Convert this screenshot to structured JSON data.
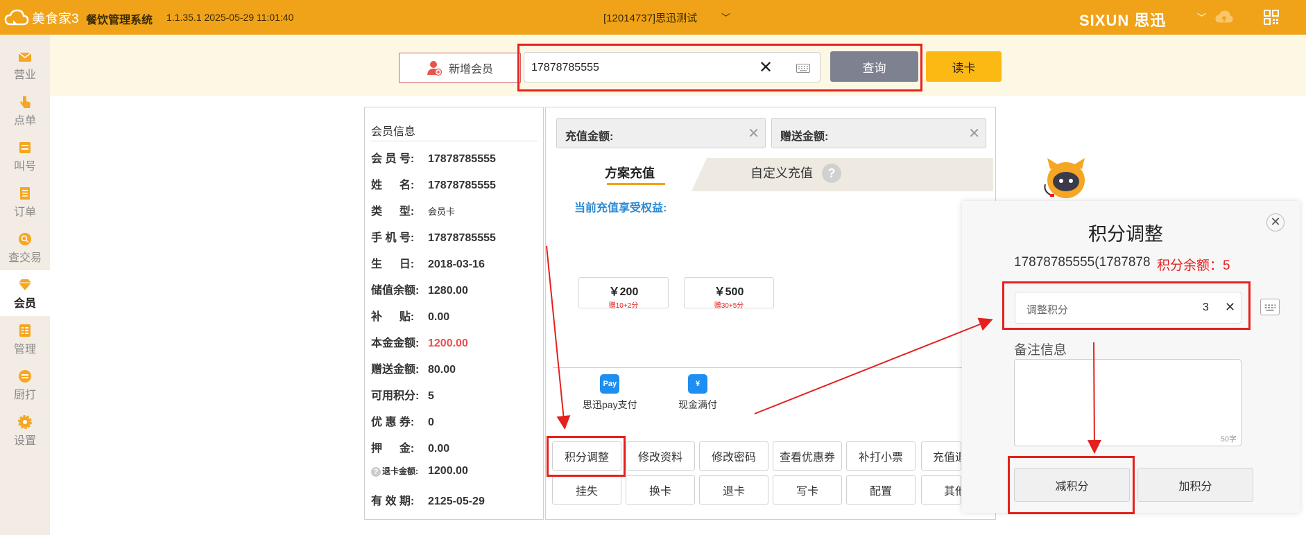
{
  "app": {
    "logo_text": "美食家3",
    "system_name": "餐饮管理系统",
    "version": "1.1.35.1 2025-05-29 11:01:40",
    "store": "[12014737]思迅测试",
    "brand": "SIXUN 思迅"
  },
  "sidebar": {
    "items": [
      {
        "label": "营业"
      },
      {
        "label": "点单"
      },
      {
        "label": "叫号"
      },
      {
        "label": "订单"
      },
      {
        "label": "查交易"
      },
      {
        "label": "会员"
      },
      {
        "label": "管理"
      },
      {
        "label": "厨打"
      },
      {
        "label": "设置"
      }
    ]
  },
  "toolbar": {
    "add_member": "新增会员",
    "search_value": "17878785555",
    "query": "查询",
    "read_card": "读卡"
  },
  "member": {
    "title": "会员信息",
    "fields": [
      {
        "label": "会 员 号:",
        "value": "17878785555"
      },
      {
        "label": "姓 　 名:",
        "value": "17878785555"
      },
      {
        "label": "类 　 型:",
        "value": "会员卡"
      },
      {
        "label": "手 机 号:",
        "value": "17878785555"
      },
      {
        "label": "生 　 日:",
        "value": "2018-03-16"
      },
      {
        "label": "储值余额:",
        "value": "1280.00"
      },
      {
        "label": "补 　 贴:",
        "value": "0.00"
      },
      {
        "label": "本金金额:",
        "value": "1200.00"
      },
      {
        "label": "赠送金额:",
        "value": "80.00"
      },
      {
        "label": "可用积分:",
        "value": "5"
      },
      {
        "label": "优 惠 券:",
        "value": "0"
      },
      {
        "label": "押 　 金:",
        "value": "0.00"
      },
      {
        "label": "退卡金额:",
        "value": "1200.00"
      },
      {
        "label": "有 效 期:",
        "value": "2125-05-29"
      }
    ]
  },
  "recharge": {
    "amount_label": "充值金额:",
    "gift_label": "赠送金额:",
    "tab_plan": "方案充值",
    "tab_custom": "自定义充值",
    "help": "?",
    "benefit_title": "当前充值享受权益:",
    "plans": [
      {
        "price": "￥200",
        "gift": "赠10+2分"
      },
      {
        "price": "￥500",
        "gift": "赠30+5分"
      }
    ],
    "payments": [
      {
        "label": "思迅pay支付",
        "icon_text": "Pay"
      },
      {
        "label": "现金满付",
        "icon_text": "¥"
      }
    ],
    "actions_row1": [
      "积分调整",
      "修改资料",
      "修改密码",
      "查看优惠券",
      "补打小票",
      "充值退"
    ],
    "actions_row2": [
      "挂失",
      "换卡",
      "退卡",
      "写卡",
      "配置",
      "其他"
    ]
  },
  "dialog": {
    "title": "积分调整",
    "member_line": "17878785555(1787878",
    "balance_line": "积分余额：5",
    "adjust_placeholder": "调整积分",
    "adjust_value": "3",
    "note_label": "备注信息",
    "note_counter": "50字",
    "decrease": "减积分",
    "increase": "加积分",
    "close": "✕"
  },
  "colors": {
    "topbar": "#f0a318",
    "highlight_red": "#e5201d",
    "query_gray": "#7e8190",
    "read_card_yellow": "#fdb913"
  }
}
